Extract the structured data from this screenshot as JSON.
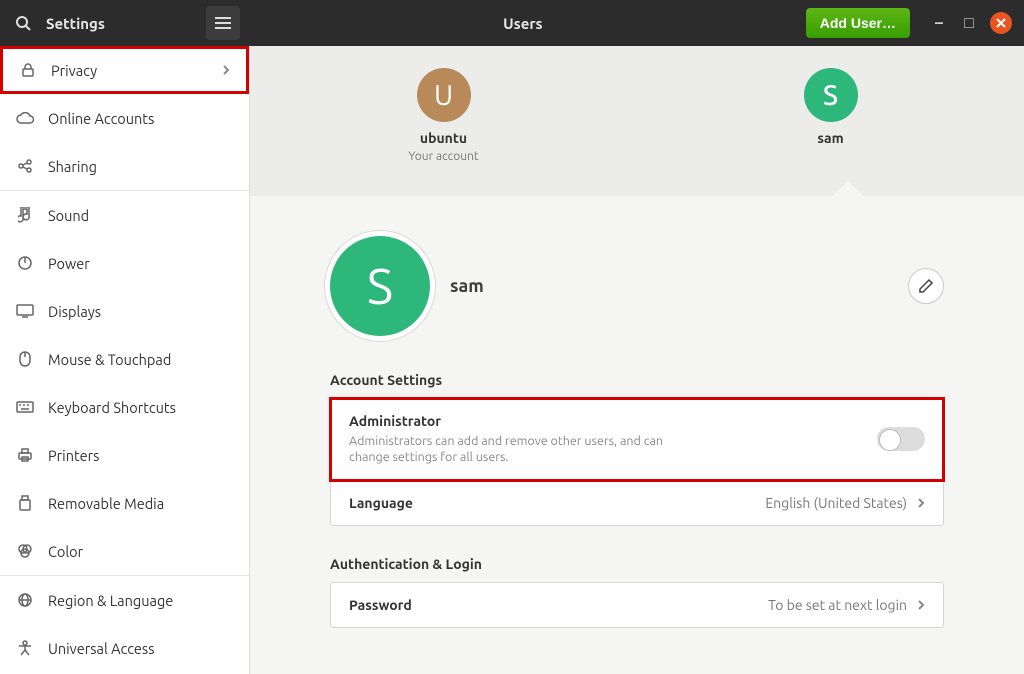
{
  "titlebar": {
    "app_title": "Settings",
    "panel_title": "Users",
    "add_user_label": "Add User…"
  },
  "sidebar": {
    "items": [
      {
        "icon": "lock",
        "label": "Privacy",
        "chevron": true,
        "highlight": true
      },
      {
        "icon": "cloud",
        "label": "Online Accounts"
      },
      {
        "icon": "share",
        "label": "Sharing"
      },
      {
        "icon": "sound",
        "label": "Sound",
        "sep": true
      },
      {
        "icon": "power",
        "label": "Power"
      },
      {
        "icon": "display",
        "label": "Displays"
      },
      {
        "icon": "mouse",
        "label": "Mouse & Touchpad"
      },
      {
        "icon": "keyboard",
        "label": "Keyboard Shortcuts"
      },
      {
        "icon": "printer",
        "label": "Printers"
      },
      {
        "icon": "usb",
        "label": "Removable Media"
      },
      {
        "icon": "color",
        "label": "Color"
      },
      {
        "icon": "region",
        "label": "Region & Language",
        "sep": true
      },
      {
        "icon": "a11y",
        "label": "Universal Access"
      }
    ]
  },
  "users_strip": {
    "users": [
      {
        "initial": "U",
        "name": "ubuntu",
        "sub": "Your account",
        "avatar_class": "ubuntu"
      },
      {
        "initial": "S",
        "name": "sam",
        "sub": "",
        "avatar_class": "sam",
        "selected": true
      }
    ]
  },
  "selected_user": {
    "initial": "S",
    "name": "sam"
  },
  "account_settings": {
    "section_label": "Account Settings",
    "administrator": {
      "title": "Administrator",
      "desc": "Administrators can add and remove other users, and can change settings for all users.",
      "enabled": false
    },
    "language": {
      "title": "Language",
      "value": "English (United States)"
    }
  },
  "auth": {
    "section_label": "Authentication & Login",
    "password": {
      "title": "Password",
      "value": "To be set at next login"
    }
  }
}
